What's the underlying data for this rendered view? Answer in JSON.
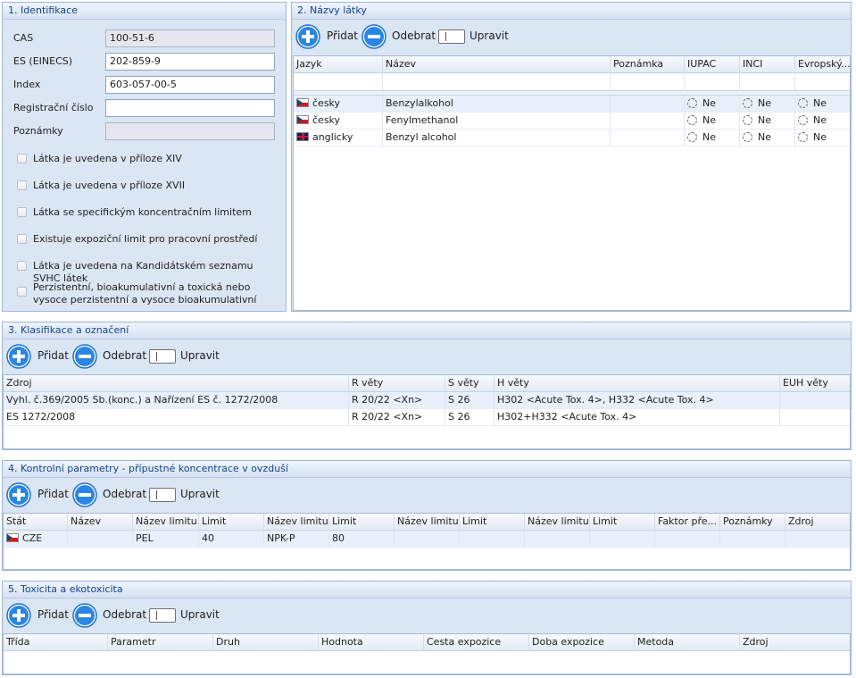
{
  "identifikace": {
    "title": "1. Identifikace",
    "fields": [
      {
        "label": "CAS",
        "value": "100-51-6",
        "readonly": true
      },
      {
        "label": "ES (EINECS)",
        "value": "202-859-9",
        "readonly": false
      },
      {
        "label": "Index",
        "value": "603-057-00-5",
        "readonly": false
      },
      {
        "label": "Registrační číslo",
        "value": "",
        "readonly": false
      },
      {
        "label": "Poznámky",
        "value": "",
        "readonly": true
      }
    ],
    "checkboxes": [
      {
        "label": "Látka je uvedena v příloze XIV",
        "checked": false
      },
      {
        "label": "Látka je uvedena v příloze XVII",
        "checked": false
      },
      {
        "label": "Látka se specifickým koncentračním limitem",
        "checked": false
      },
      {
        "label": "Existuje expoziční limit pro pracovní prostředí",
        "checked": false
      },
      {
        "label": "Látka je uvedena na Kandidátském seznamu SVHC látek",
        "checked": false
      },
      {
        "label": "Perzistentní, bioakumulativní a toxická nebo vysoce perzistentní a vysoce bioakumulativní",
        "checked": false
      }
    ]
  },
  "toolbar": {
    "add_label": "Přidat",
    "remove_label": "Odebrat",
    "edit_label": "Upravit"
  },
  "nazvy": {
    "title": "2. Názvy látky",
    "columns": [
      "Jazyk",
      "Název",
      "Poznámka",
      "IUPAC",
      "INCI",
      "Evropský..."
    ],
    "rows": [
      {
        "flag": "cz",
        "jazyk": "česky",
        "nazev": "Benzylalkohol",
        "poznamka": "",
        "iupac": "Ne",
        "inci": "Ne",
        "evropsky": "Ne"
      },
      {
        "flag": "cz",
        "jazyk": "česky",
        "nazev": "Fenylmethanol",
        "poznamka": "",
        "iupac": "Ne",
        "inci": "Ne",
        "evropsky": "Ne"
      },
      {
        "flag": "gb",
        "jazyk": "anglicky",
        "nazev": "Benzyl alcohol",
        "poznamka": "",
        "iupac": "Ne",
        "inci": "Ne",
        "evropsky": "Ne"
      }
    ]
  },
  "klasifikace": {
    "title": "3. Klasifikace a označení",
    "columns": [
      "Zdroj",
      "R věty",
      "S věty",
      "H věty",
      "EUH věty"
    ],
    "rows": [
      [
        "Vyhl. č.369/2005 Sb.(konc.) a Nařízení ES č. 1272/2008",
        "R 20/22 <Xn>",
        "S 26",
        "H302 <Acute Tox. 4>, H332 <Acute Tox. 4>",
        ""
      ],
      [
        "ES 1272/2008",
        "R 20/22 <Xn>",
        "S 26",
        "H302+H332 <Acute Tox. 4>",
        ""
      ]
    ]
  },
  "kontrolni": {
    "title": "4. Kontrolní parametry - přípustné koncentrace v ovzduší",
    "columns": [
      "Stát",
      "Název",
      "Název limitu",
      "Limit",
      "Název limitu",
      "Limit",
      "Název limitu",
      "Limit",
      "Název limitu",
      "Limit",
      "Faktor pře...",
      "Poznámky",
      "Zdroj"
    ],
    "rows": [
      {
        "flag": "cz",
        "cells": [
          "CZE",
          "",
          "PEL",
          "40",
          "NPK-P",
          "80",
          "",
          "",
          "",
          "",
          "",
          "",
          ""
        ]
      }
    ]
  },
  "toxicita": {
    "title": "5. Toxicita a ekotoxicita",
    "columns": [
      "Třída",
      "Parametr",
      "Druh",
      "Hodnota",
      "Cesta expozice",
      "Doba expozice",
      "Metoda",
      "Zdroj"
    ]
  }
}
